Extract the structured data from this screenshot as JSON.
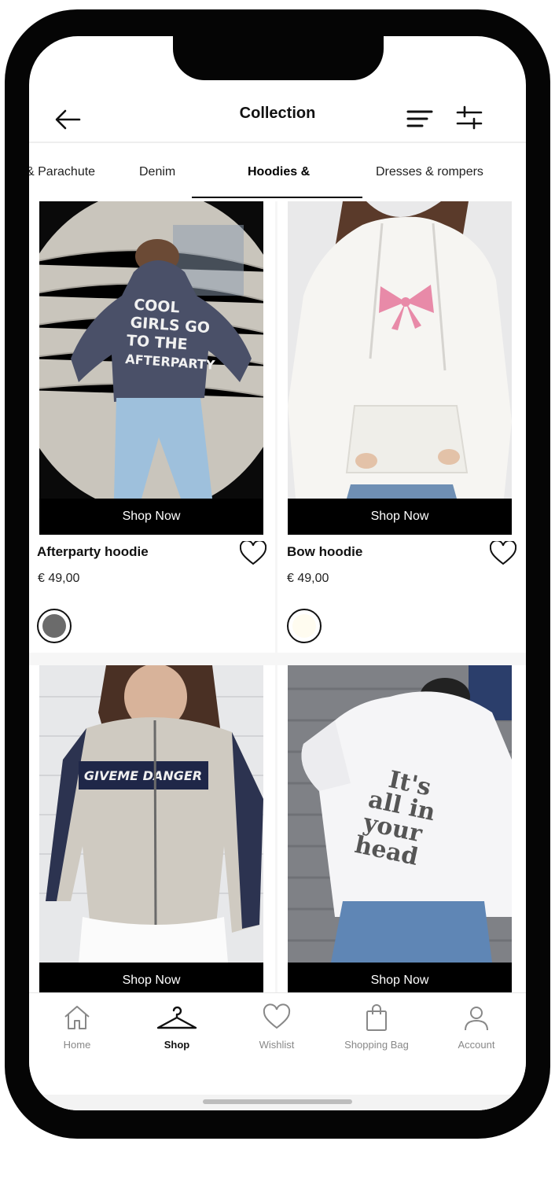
{
  "header": {
    "title": "Collection"
  },
  "tabs": [
    {
      "label": "& Parachute",
      "active": false
    },
    {
      "label": "Denim",
      "active": false
    },
    {
      "label": "Hoodies &",
      "active": true
    },
    {
      "label": "Dresses & rompers",
      "active": false
    }
  ],
  "products": [
    {
      "name": "Afterparty hoodie",
      "price": "€ 49,00",
      "cta": "Shop Now",
      "swatch_color": "#6b6b6b",
      "print_lines": [
        "COOL",
        "GIRLS GO",
        "TO THE",
        "AFTERPARTY"
      ]
    },
    {
      "name": "Bow hoodie",
      "price": "€ 49,00",
      "cta": "Shop Now",
      "swatch_color": "#fffcf0"
    },
    {
      "cta": "Shop Now",
      "print_text": "GIVEME DANGER"
    },
    {
      "cta": "Shop Now",
      "print_lines": [
        "It's",
        "all in",
        "your",
        "head"
      ]
    }
  ],
  "bottom_nav": [
    {
      "label": "Home",
      "icon": "home-icon",
      "active": false
    },
    {
      "label": "Shop",
      "icon": "hanger-icon",
      "active": true
    },
    {
      "label": "Wishlist",
      "icon": "heart-icon",
      "active": false
    },
    {
      "label": "Shopping Bag",
      "icon": "bag-icon",
      "active": false
    },
    {
      "label": "Account",
      "icon": "person-icon",
      "active": false
    }
  ],
  "colors": {
    "accent": "#000000",
    "inactive_nav": "#888888",
    "bow_pink": "#e88aa8",
    "hoodie_navy": "#4a5068"
  }
}
